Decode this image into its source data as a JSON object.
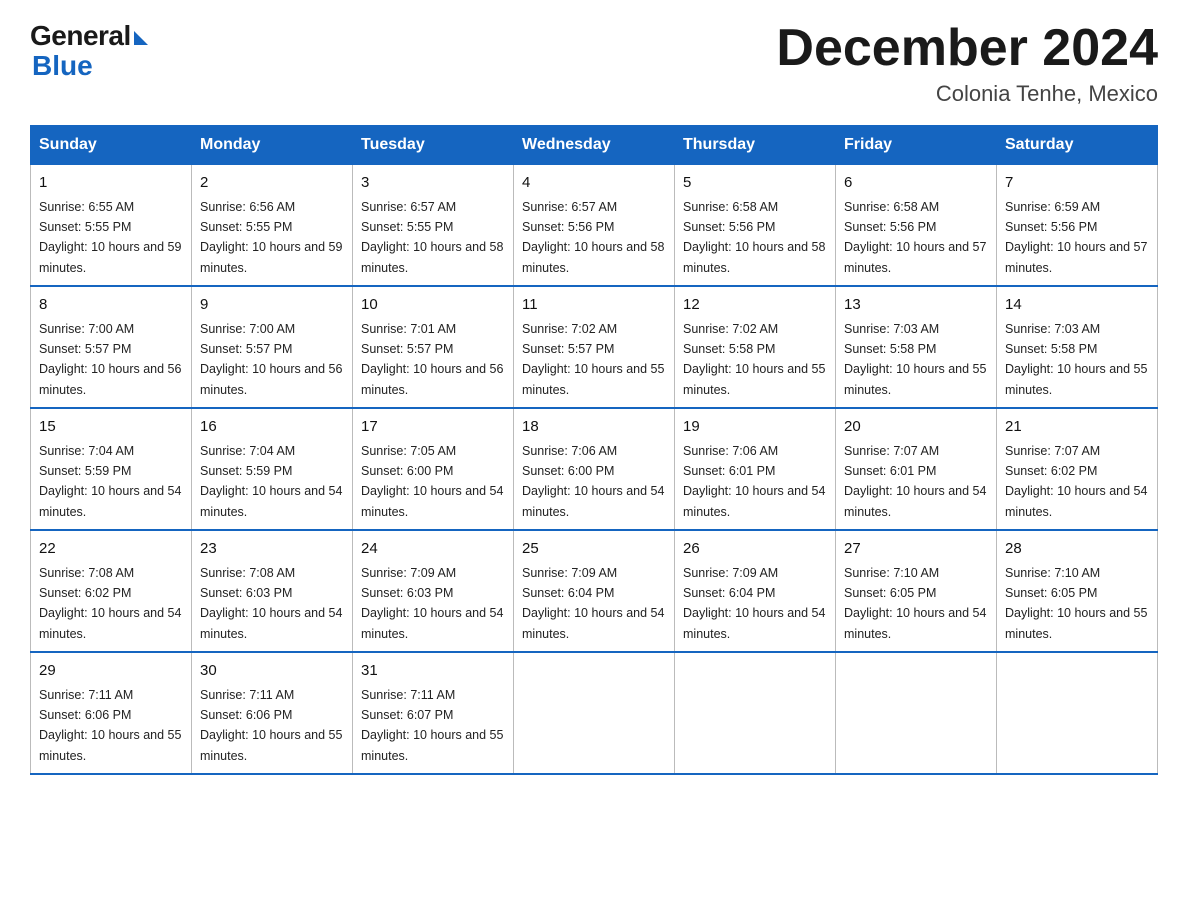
{
  "header": {
    "logo_general": "General",
    "logo_blue": "Blue",
    "month_title": "December 2024",
    "location": "Colonia Tenhe, Mexico"
  },
  "days_of_week": [
    "Sunday",
    "Monday",
    "Tuesday",
    "Wednesday",
    "Thursday",
    "Friday",
    "Saturday"
  ],
  "weeks": [
    [
      {
        "num": "1",
        "sunrise": "6:55 AM",
        "sunset": "5:55 PM",
        "daylight": "10 hours and 59 minutes."
      },
      {
        "num": "2",
        "sunrise": "6:56 AM",
        "sunset": "5:55 PM",
        "daylight": "10 hours and 59 minutes."
      },
      {
        "num": "3",
        "sunrise": "6:57 AM",
        "sunset": "5:55 PM",
        "daylight": "10 hours and 58 minutes."
      },
      {
        "num": "4",
        "sunrise": "6:57 AM",
        "sunset": "5:56 PM",
        "daylight": "10 hours and 58 minutes."
      },
      {
        "num": "5",
        "sunrise": "6:58 AM",
        "sunset": "5:56 PM",
        "daylight": "10 hours and 58 minutes."
      },
      {
        "num": "6",
        "sunrise": "6:58 AM",
        "sunset": "5:56 PM",
        "daylight": "10 hours and 57 minutes."
      },
      {
        "num": "7",
        "sunrise": "6:59 AM",
        "sunset": "5:56 PM",
        "daylight": "10 hours and 57 minutes."
      }
    ],
    [
      {
        "num": "8",
        "sunrise": "7:00 AM",
        "sunset": "5:57 PM",
        "daylight": "10 hours and 56 minutes."
      },
      {
        "num": "9",
        "sunrise": "7:00 AM",
        "sunset": "5:57 PM",
        "daylight": "10 hours and 56 minutes."
      },
      {
        "num": "10",
        "sunrise": "7:01 AM",
        "sunset": "5:57 PM",
        "daylight": "10 hours and 56 minutes."
      },
      {
        "num": "11",
        "sunrise": "7:02 AM",
        "sunset": "5:57 PM",
        "daylight": "10 hours and 55 minutes."
      },
      {
        "num": "12",
        "sunrise": "7:02 AM",
        "sunset": "5:58 PM",
        "daylight": "10 hours and 55 minutes."
      },
      {
        "num": "13",
        "sunrise": "7:03 AM",
        "sunset": "5:58 PM",
        "daylight": "10 hours and 55 minutes."
      },
      {
        "num": "14",
        "sunrise": "7:03 AM",
        "sunset": "5:58 PM",
        "daylight": "10 hours and 55 minutes."
      }
    ],
    [
      {
        "num": "15",
        "sunrise": "7:04 AM",
        "sunset": "5:59 PM",
        "daylight": "10 hours and 54 minutes."
      },
      {
        "num": "16",
        "sunrise": "7:04 AM",
        "sunset": "5:59 PM",
        "daylight": "10 hours and 54 minutes."
      },
      {
        "num": "17",
        "sunrise": "7:05 AM",
        "sunset": "6:00 PM",
        "daylight": "10 hours and 54 minutes."
      },
      {
        "num": "18",
        "sunrise": "7:06 AM",
        "sunset": "6:00 PM",
        "daylight": "10 hours and 54 minutes."
      },
      {
        "num": "19",
        "sunrise": "7:06 AM",
        "sunset": "6:01 PM",
        "daylight": "10 hours and 54 minutes."
      },
      {
        "num": "20",
        "sunrise": "7:07 AM",
        "sunset": "6:01 PM",
        "daylight": "10 hours and 54 minutes."
      },
      {
        "num": "21",
        "sunrise": "7:07 AM",
        "sunset": "6:02 PM",
        "daylight": "10 hours and 54 minutes."
      }
    ],
    [
      {
        "num": "22",
        "sunrise": "7:08 AM",
        "sunset": "6:02 PM",
        "daylight": "10 hours and 54 minutes."
      },
      {
        "num": "23",
        "sunrise": "7:08 AM",
        "sunset": "6:03 PM",
        "daylight": "10 hours and 54 minutes."
      },
      {
        "num": "24",
        "sunrise": "7:09 AM",
        "sunset": "6:03 PM",
        "daylight": "10 hours and 54 minutes."
      },
      {
        "num": "25",
        "sunrise": "7:09 AM",
        "sunset": "6:04 PM",
        "daylight": "10 hours and 54 minutes."
      },
      {
        "num": "26",
        "sunrise": "7:09 AM",
        "sunset": "6:04 PM",
        "daylight": "10 hours and 54 minutes."
      },
      {
        "num": "27",
        "sunrise": "7:10 AM",
        "sunset": "6:05 PM",
        "daylight": "10 hours and 54 minutes."
      },
      {
        "num": "28",
        "sunrise": "7:10 AM",
        "sunset": "6:05 PM",
        "daylight": "10 hours and 55 minutes."
      }
    ],
    [
      {
        "num": "29",
        "sunrise": "7:11 AM",
        "sunset": "6:06 PM",
        "daylight": "10 hours and 55 minutes."
      },
      {
        "num": "30",
        "sunrise": "7:11 AM",
        "sunset": "6:06 PM",
        "daylight": "10 hours and 55 minutes."
      },
      {
        "num": "31",
        "sunrise": "7:11 AM",
        "sunset": "6:07 PM",
        "daylight": "10 hours and 55 minutes."
      },
      null,
      null,
      null,
      null
    ]
  ]
}
